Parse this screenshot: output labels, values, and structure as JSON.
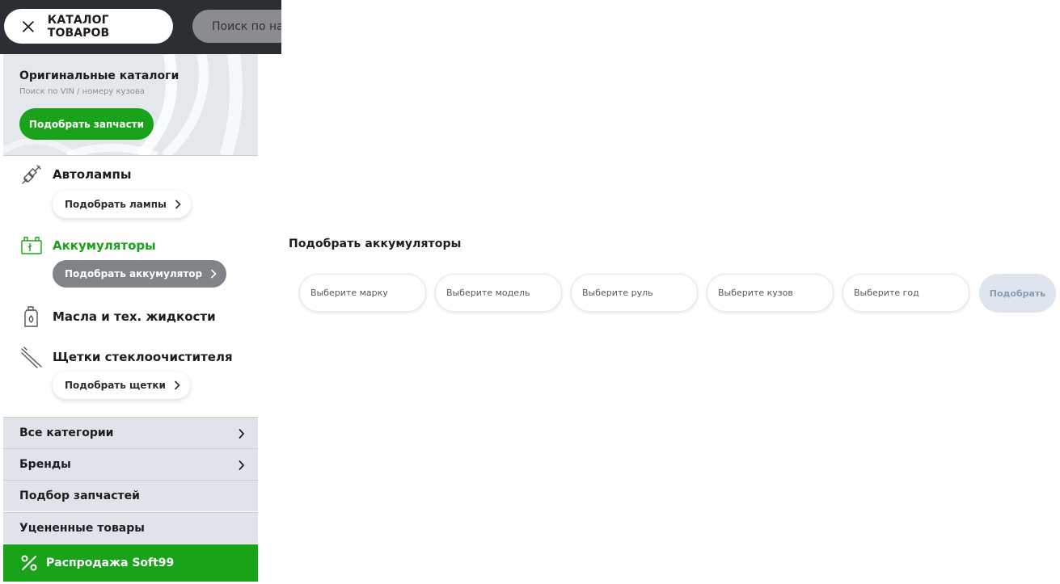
{
  "header": {
    "catalog_button": "КАТАЛОГ ТОВАРОВ",
    "search_placeholder": "Поиск по названию, артикулу"
  },
  "original_catalogs": {
    "title": "Оригинальные каталоги",
    "subtitle": "Поиск по VIN / номеру кузова",
    "button": "Подобрать запчасти"
  },
  "categories": [
    {
      "name": "Автолампы",
      "icon": "spark-plug-icon",
      "action": "Подобрать лампы",
      "active": false
    },
    {
      "name": "Аккумуляторы",
      "icon": "battery-icon",
      "action": "Подобрать аккумулятор",
      "active": true
    },
    {
      "name": "Масла и тех. жидкости",
      "icon": "oil-bottle-icon",
      "action": null,
      "active": false
    },
    {
      "name": "Щетки стеклоочистителя",
      "icon": "wiper-icon",
      "action": "Подобрать щетки",
      "active": false
    }
  ],
  "nav": [
    {
      "label": "Все категории",
      "has_chevron": true
    },
    {
      "label": "Бренды",
      "has_chevron": true
    },
    {
      "label": "Подбор запчастей",
      "has_chevron": false
    },
    {
      "label": "Уцененные товары",
      "has_chevron": false
    }
  ],
  "sale": {
    "label": "Распродажа Soft99",
    "icon": "percent-icon"
  },
  "battery_selector": {
    "title": "Подобрать аккумуляторы",
    "fields": [
      "Выберите марку",
      "Выберите модель",
      "Выберите руль",
      "Выберите кузов",
      "Выберите год"
    ],
    "submit": "Подобрать"
  },
  "colors": {
    "accent_green": "#1aa31a",
    "topbar": "#2b2e32",
    "nav_bg": "#dfe4ea"
  }
}
